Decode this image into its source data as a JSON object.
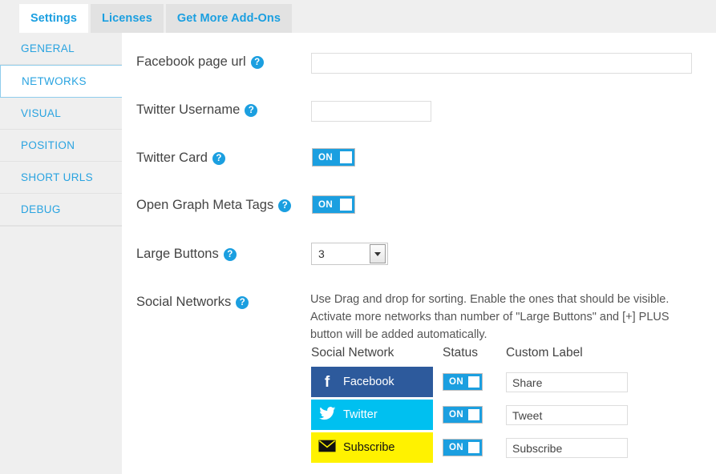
{
  "tabs": [
    {
      "label": "Settings",
      "active": true
    },
    {
      "label": "Licenses",
      "active": false
    },
    {
      "label": "Get More Add-Ons",
      "active": false
    }
  ],
  "sidebar": {
    "items": [
      {
        "label": "GENERAL",
        "active": false
      },
      {
        "label": "NETWORKS",
        "active": true
      },
      {
        "label": "VISUAL",
        "active": false
      },
      {
        "label": "POSITION",
        "active": false
      },
      {
        "label": "SHORT URLS",
        "active": false
      },
      {
        "label": "DEBUG",
        "active": false
      }
    ]
  },
  "fields": {
    "facebook_url": {
      "label": "Facebook page url",
      "help": "?",
      "value": "",
      "placeholder": ""
    },
    "twitter_username": {
      "label": "Twitter Username",
      "help": "?",
      "value": "",
      "placeholder": ""
    },
    "twitter_card": {
      "label": "Twitter Card",
      "help": "?",
      "toggle": "ON"
    },
    "open_graph": {
      "label": "Open Graph Meta Tags",
      "help": "?",
      "toggle": "ON"
    },
    "large_buttons": {
      "label": "Large Buttons",
      "help": "?",
      "value": "3"
    },
    "social_networks": {
      "label": "Social Networks",
      "help": "?"
    }
  },
  "description": "Use Drag and drop for sorting. Enable the ones that should be visible. Activate more networks than number of \"Large Buttons\" and [+] PLUS button will be added automatically.",
  "table": {
    "headers": {
      "network": "Social Network",
      "status": "Status",
      "custom_label": "Custom Label"
    },
    "rows": [
      {
        "name": "Facebook",
        "icon": "facebook-icon",
        "glyph": "f",
        "bg": "#2d5a9c",
        "fg": "#ffffff",
        "status": "ON",
        "custom_label": "Share"
      },
      {
        "name": "Twitter",
        "icon": "twitter-icon",
        "glyph": "🐦",
        "bg": "#00c0f0",
        "fg": "#ffffff",
        "status": "ON",
        "custom_label": "Tweet"
      },
      {
        "name": "Subscribe",
        "icon": "envelope-icon",
        "glyph": "✉",
        "bg": "#fff200",
        "fg": "#111111",
        "status": "ON",
        "custom_label": "Subscribe"
      }
    ]
  },
  "colors": {
    "accent": "#1b9fe0",
    "tabbar_bg": "#efefef",
    "sidebar_bg": "#efefef",
    "active_tab_bg": "#ffffff"
  }
}
